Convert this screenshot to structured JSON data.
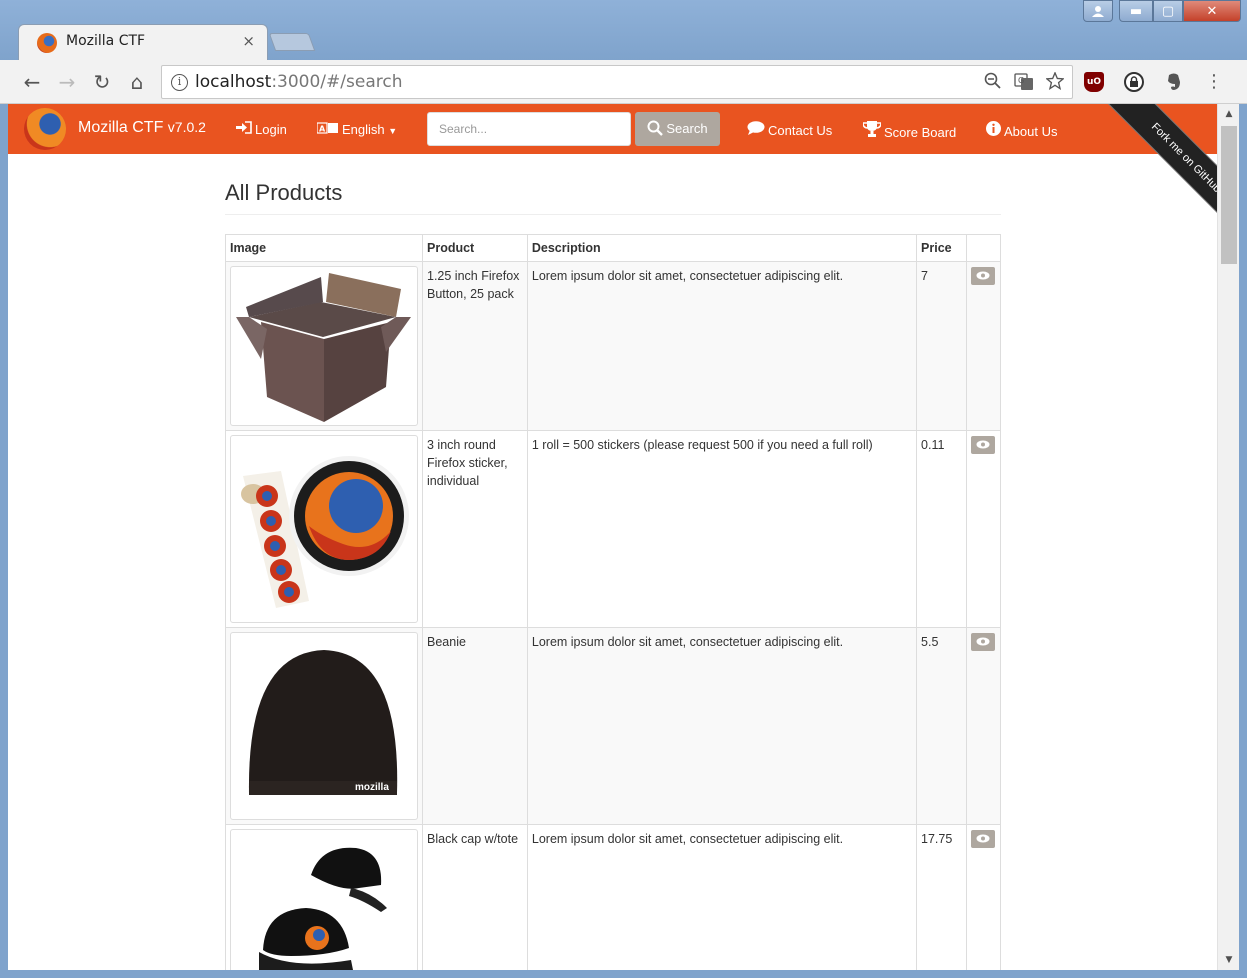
{
  "browser": {
    "tab_title": "Mozilla CTF",
    "tab_close": "×",
    "url_host": "localhost",
    "url_rest": ":3000/#/search",
    "back": "←",
    "forward": "→",
    "reload": "↻",
    "home": "⌂",
    "win_min": "▬",
    "win_max": "▢",
    "win_close": "✕",
    "ext_ublock": "uO",
    "menu": "⋮"
  },
  "navbar": {
    "brand": "Mozilla CTF",
    "version": "v7.0.2",
    "login": "Login",
    "language": "English",
    "search_placeholder": "Search...",
    "search_button": "Search",
    "contact": "Contact Us",
    "score_board": "Score Board",
    "about": "About Us",
    "ribbon": "Fork me on GitHub"
  },
  "main": {
    "title": "All Products",
    "columns": [
      "Image",
      "Product",
      "Description",
      "Price",
      ""
    ],
    "products": [
      {
        "name": "1.25 inch Firefox Button, 25 pack",
        "description": "Lorem ipsum dolor sit amet, consectetuer adipiscing elit.",
        "price": "7"
      },
      {
        "name": "3 inch round Firefox sticker, individual",
        "description": "1 roll = 500 stickers (please request 500 if you need a full roll)",
        "price": "0.11"
      },
      {
        "name": "Beanie",
        "description": "Lorem ipsum dolor sit amet, consectetuer adipiscing elit.",
        "price": "5.5"
      },
      {
        "name": "Black cap w/tote",
        "description": "Lorem ipsum dolor sit amet, consectetuer adipiscing elit.",
        "price": "17.75"
      }
    ],
    "beanie_label": "mozilla"
  },
  "colors": {
    "navbar": "#e95420",
    "button": "#aea79f"
  }
}
